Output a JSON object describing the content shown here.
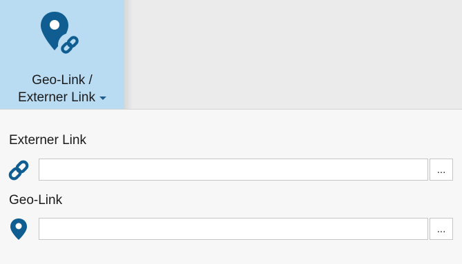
{
  "ribbon": {
    "button_line1": "Geo-Link /",
    "button_line2": "Externer Link",
    "icon": "map-pin-link-icon",
    "dropdown_icon": "chevron-down-icon",
    "accent_color": "#0f5d91",
    "button_bg": "#b9dcf2"
  },
  "form": {
    "external_link": {
      "label": "Externer Link",
      "icon": "link-icon",
      "value": "",
      "browse_label": "..."
    },
    "geo_link": {
      "label": "Geo-Link",
      "icon": "map-pin-icon",
      "value": "",
      "browse_label": "..."
    }
  }
}
